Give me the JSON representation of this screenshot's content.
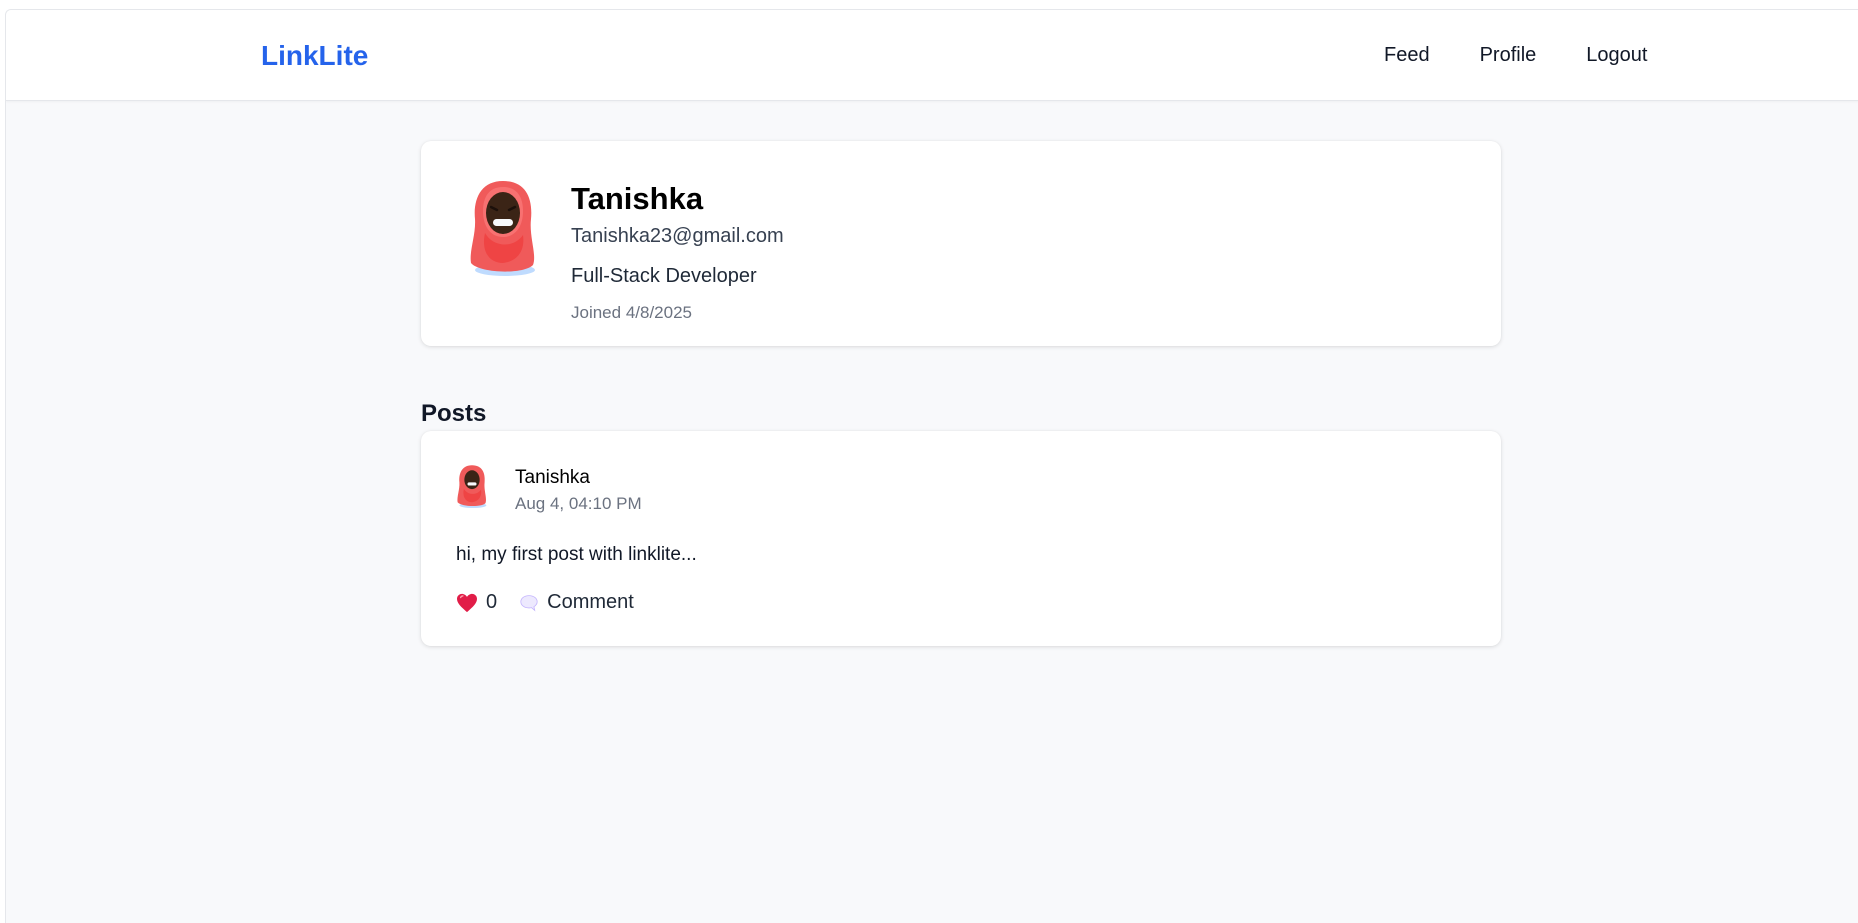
{
  "nav": {
    "brand": "LinkLite",
    "links": [
      "Feed",
      "Profile",
      "Logout"
    ]
  },
  "profile": {
    "name": "Tanishka",
    "email": "Tanishka23@gmail.com",
    "bio": "Full-Stack Developer",
    "joined": "Joined 4/8/2025",
    "avatar_icon": "hijab-woman-avatar-icon"
  },
  "posts_section": {
    "title": "Posts"
  },
  "posts": [
    {
      "author": "Tanishka",
      "time": "Aug 4, 04:10 PM",
      "body": "hi, my first post with linklite...",
      "likes": "0",
      "comment_label": "Comment",
      "like_icon": "heart-icon",
      "comment_icon": "speech-bubble-icon"
    }
  ],
  "colors": {
    "brand": "#2563eb",
    "background": "#f8f9fb",
    "card": "#ffffff",
    "heart": "#e11d48"
  }
}
